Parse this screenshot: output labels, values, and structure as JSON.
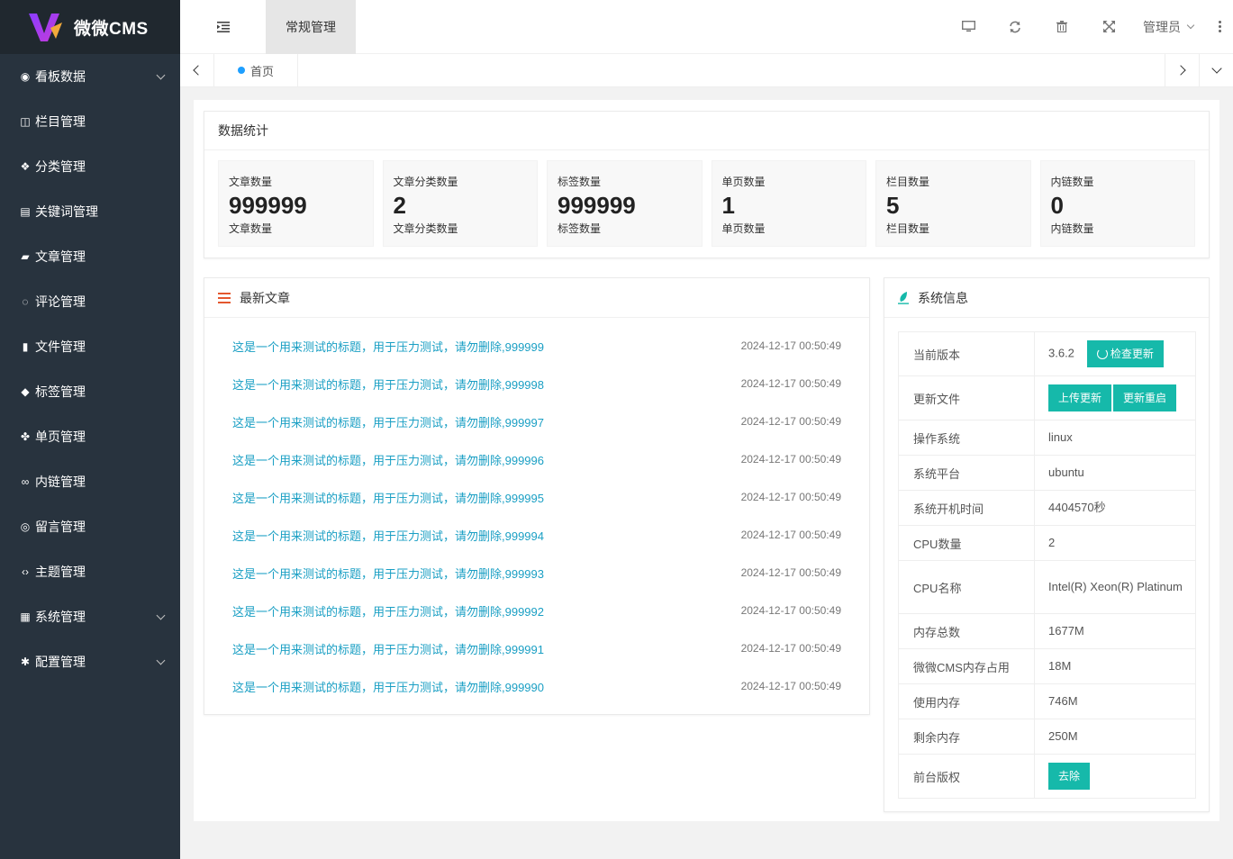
{
  "brand": {
    "name": "微微CMS"
  },
  "sidebar": {
    "items": [
      {
        "label": "看板数据",
        "icon": "dashboard-icon",
        "glyph": "◉",
        "has_arrow": true
      },
      {
        "label": "栏目管理",
        "icon": "columns-icon",
        "glyph": "◫",
        "has_arrow": false
      },
      {
        "label": "分类管理",
        "icon": "cube-icon",
        "glyph": "❖",
        "has_arrow": false
      },
      {
        "label": "关键词管理",
        "icon": "keyword-icon",
        "glyph": "▤",
        "has_arrow": false
      },
      {
        "label": "文章管理",
        "icon": "book-icon",
        "glyph": "▰",
        "has_arrow": false
      },
      {
        "label": "评论管理",
        "icon": "comment-icon",
        "glyph": "◌",
        "has_arrow": false
      },
      {
        "label": "文件管理",
        "icon": "file-icon",
        "glyph": "▮",
        "has_arrow": false
      },
      {
        "label": "标签管理",
        "icon": "tags-icon",
        "glyph": "◆",
        "has_arrow": false
      },
      {
        "label": "单页管理",
        "icon": "page-icon",
        "glyph": "✤",
        "has_arrow": false
      },
      {
        "label": "内链管理",
        "icon": "link-icon",
        "glyph": "∞",
        "has_arrow": false
      },
      {
        "label": "留言管理",
        "icon": "message-icon",
        "glyph": "◎",
        "has_arrow": false
      },
      {
        "label": "主题管理",
        "icon": "code-icon",
        "glyph": "‹›",
        "has_arrow": false
      },
      {
        "label": "系统管理",
        "icon": "windows-icon",
        "glyph": "▦",
        "has_arrow": true
      },
      {
        "label": "配置管理",
        "icon": "gears-icon",
        "glyph": "✱",
        "has_arrow": true
      }
    ]
  },
  "header": {
    "top_tab": "常规管理",
    "admin_label": "管理员"
  },
  "tabbar": {
    "home_label": "首页"
  },
  "stats": {
    "title": "数据统计",
    "items": [
      {
        "label": "文章数量",
        "value": "999999",
        "sub": "文章数量"
      },
      {
        "label": "文章分类数量",
        "value": "2",
        "sub": "文章分类数量"
      },
      {
        "label": "标签数量",
        "value": "999999",
        "sub": "标签数量"
      },
      {
        "label": "单页数量",
        "value": "1",
        "sub": "单页数量"
      },
      {
        "label": "栏目数量",
        "value": "5",
        "sub": "栏目数量"
      },
      {
        "label": "内链数量",
        "value": "0",
        "sub": "内链数量"
      }
    ]
  },
  "articles": {
    "title": "最新文章",
    "items": [
      {
        "title": "这是一个用来测试的标题，用于压力测试，请勿删除,999999",
        "date": "2024-12-17 00:50:49"
      },
      {
        "title": "这是一个用来测试的标题，用于压力测试，请勿删除,999998",
        "date": "2024-12-17 00:50:49"
      },
      {
        "title": "这是一个用来测试的标题，用于压力测试，请勿删除,999997",
        "date": "2024-12-17 00:50:49"
      },
      {
        "title": "这是一个用来测试的标题，用于压力测试，请勿删除,999996",
        "date": "2024-12-17 00:50:49"
      },
      {
        "title": "这是一个用来测试的标题，用于压力测试，请勿删除,999995",
        "date": "2024-12-17 00:50:49"
      },
      {
        "title": "这是一个用来测试的标题，用于压力测试，请勿删除,999994",
        "date": "2024-12-17 00:50:49"
      },
      {
        "title": "这是一个用来测试的标题，用于压力测试，请勿删除,999993",
        "date": "2024-12-17 00:50:49"
      },
      {
        "title": "这是一个用来测试的标题，用于压力测试，请勿删除,999992",
        "date": "2024-12-17 00:50:49"
      },
      {
        "title": "这是一个用来测试的标题，用于压力测试，请勿删除,999991",
        "date": "2024-12-17 00:50:49"
      },
      {
        "title": "这是一个用来测试的标题，用于压力测试，请勿删除,999990",
        "date": "2024-12-17 00:50:49"
      }
    ]
  },
  "system": {
    "title": "系统信息",
    "version_label": "当前版本",
    "version": "3.6.2",
    "check_update_label": "检查更新",
    "update_file_label": "更新文件",
    "upload_update_label": "上传更新",
    "update_restart_label": "更新重启",
    "os_label": "操作系统",
    "os": "linux",
    "platform_label": "系统平台",
    "platform": "ubuntu",
    "uptime_label": "系统开机时间",
    "uptime": "4404570秒",
    "cpu_count_label": "CPU数量",
    "cpu_count": "2",
    "cpu_name_label": "CPU名称",
    "cpu_name": "Intel(R) Xeon(R) Platinum",
    "mem_total_label": "内存总数",
    "mem_total": "1677M",
    "cms_mem_label": "微微CMS内存占用",
    "cms_mem": "18M",
    "mem_used_label": "使用内存",
    "mem_used": "746M",
    "mem_free_label": "剩余内存",
    "mem_free": "250M",
    "copyright_label": "前台版权",
    "remove_label": "去除"
  },
  "colors": {
    "sidebar_bg": "#28333e",
    "logo_bg": "#20282f",
    "accent_teal": "#16b9aa",
    "link_blue": "#1a9fc4",
    "tab_dot": "#1e9fff",
    "list_icon": "#e4572e"
  }
}
